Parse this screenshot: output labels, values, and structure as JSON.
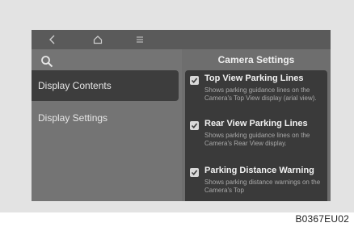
{
  "header": {
    "title": "Camera Settings"
  },
  "nav": {
    "back_icon": "back-chevron",
    "home_icon": "home",
    "menu_icon": "menu-lines",
    "search_icon": "search"
  },
  "sidebar": {
    "items": [
      {
        "label": "Display Contents",
        "selected": true
      },
      {
        "label": "Display Settings",
        "selected": false
      }
    ]
  },
  "options": [
    {
      "title": "Top View Parking Lines",
      "desc": "Shows parking guidance lines on the Camera's Top View display (arial view).",
      "checked": true
    },
    {
      "title": "Rear View Parking Lines",
      "desc": "Shows parking guidance lines on the Camera's Rear View display.",
      "checked": true
    },
    {
      "title": "Parking Distance Warning",
      "desc": "Shows parking distance warnings on the Camera's Top",
      "checked": true
    }
  ],
  "figure_code": "B0367EU02",
  "colors": {
    "screen_bg": "#6e6e6e",
    "selected_bg": "#3d3d3d",
    "panel_bg": "#3a3a3a"
  }
}
